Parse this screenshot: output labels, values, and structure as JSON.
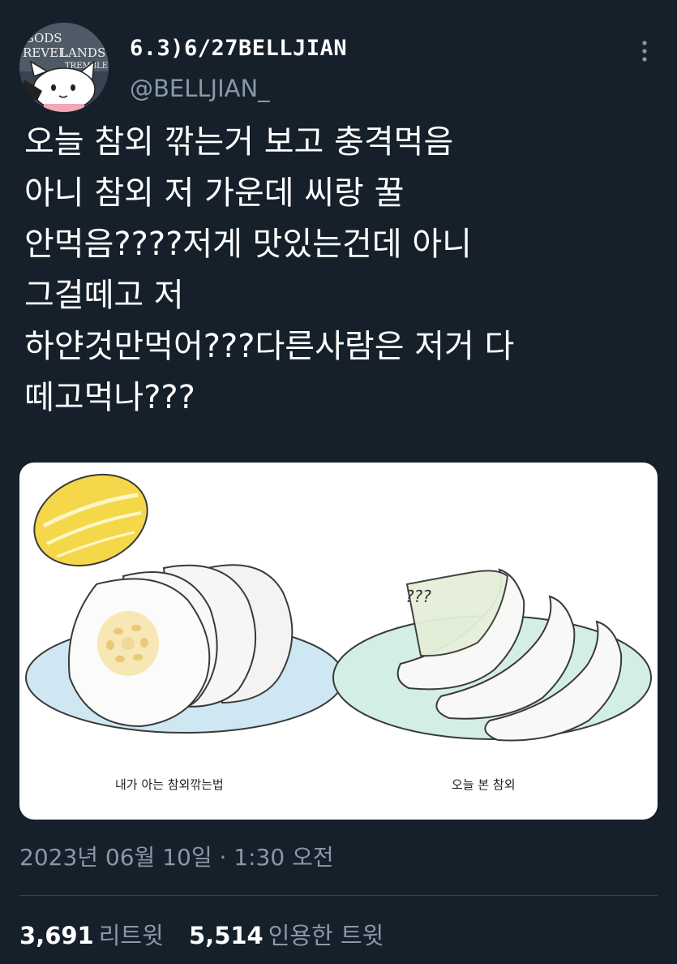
{
  "author": {
    "display_name": "6.3)6/27BELLJIAN",
    "handle": "@BELLJIAN_",
    "avatar_text": [
      "GODS",
      "REVEL",
      "LANDS",
      "TREMBLE"
    ]
  },
  "tweet": {
    "lines": [
      "오늘 참외 깎는거 보고 충격먹음",
      "아니 참외 저 가운데 씨랑 꿀",
      "안먹음????저게 맛있는건데 아니",
      "그걸떼고 저",
      "하얀것만먹어???다른사람은 저거 다",
      "떼고먹나???"
    ]
  },
  "media": {
    "left_caption": "내가 아는 참외깎는법",
    "right_caption": "오늘 본 참외",
    "question_marks": "???"
  },
  "timestamp": "2023년 06월 10일 · 1:30 오전",
  "stats": {
    "retweets_count": "3,691",
    "retweets_label": "리트윗",
    "quotes_count": "5,514",
    "quotes_label": "인용한 트윗"
  },
  "colors": {
    "background": "#15202b",
    "secondary_text": "#8899a6",
    "divider": "#38444d",
    "melon_yellow": "#f4d84a",
    "plate_blue": "#cfe7f2",
    "plate_green": "#d3eee7"
  },
  "icons": {
    "more": "more-dots-vertical-icon"
  }
}
